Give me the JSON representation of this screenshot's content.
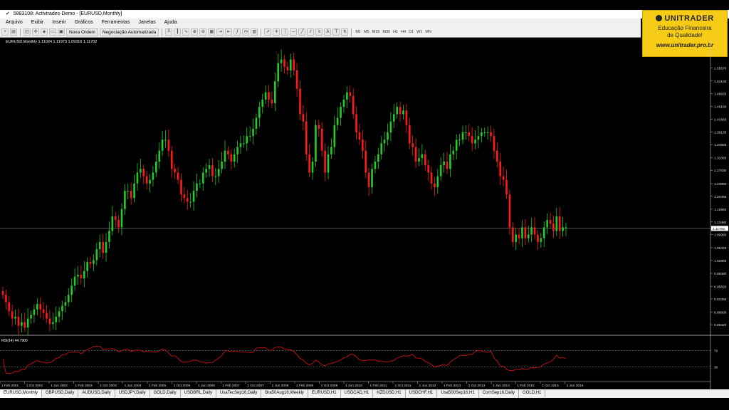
{
  "window": {
    "title": "5883108: Activtrades-Demo - [EURUSD,Monthly]"
  },
  "menu": [
    "Arquivo",
    "Exibir",
    "Inserir",
    "Gráficos",
    "Ferramentas",
    "Janelas",
    "Ajuda"
  ],
  "toolbar": {
    "new_order": "Nova Ordem",
    "auto_trading": "Negociação Automatizada",
    "timeframes": [
      "M1",
      "M5",
      "M15",
      "M30",
      "H1",
      "H4",
      "D1",
      "W1",
      "MN"
    ]
  },
  "banner": {
    "brand": "UNITRADER",
    "tagline_1": "Educação Financeira",
    "tagline_2": "de Qualidade!",
    "url": "www.unitrader.pro.br"
  },
  "chart_data": {
    "type": "candlestick",
    "symbol_info": "EURUSD,Monthly  1.11024 1.11973 1.09316 1.11702",
    "current_price": "1.11702",
    "ylim": [
      0.83,
      1.62
    ],
    "yticks": [
      "1.55670",
      "1.52100",
      "1.48635",
      "1.45150",
      "1.41660",
      "1.38135",
      "1.34665",
      "1.31095",
      "1.27630",
      "1.23960",
      "1.20495",
      "1.16960",
      "1.13460",
      "1.09990",
      "1.06425",
      "1.02885",
      "0.99380",
      "0.95820",
      "0.92355",
      "0.88800",
      "0.85320"
    ],
    "xticks": [
      "1 Feb 2001",
      "1 Oct 2001",
      "1 Jun 2002",
      "1 Feb 2003",
      "1 Oct 2003",
      "1 Jun 2004",
      "1 Feb 2005",
      "1 Oct 2005",
      "1 Jun 2006",
      "1 Feb 2007",
      "1 Oct 2007",
      "1 Jun 2008",
      "1 Feb 2009",
      "1 Oct 2009",
      "1 Jun 2010",
      "1 Feb 2011",
      "1 Oct 2011",
      "1 Jun 2012",
      "1 Feb 2013",
      "1 Oct 2013",
      "1 Jun 2014",
      "1 Feb 2015",
      "1 Oct 2015",
      "1 Jun 2016"
    ],
    "closes": [
      0.935,
      0.915,
      0.89,
      0.87,
      0.875,
      0.85,
      0.86,
      0.845,
      0.87,
      0.88,
      0.895,
      0.91,
      0.895,
      0.885,
      0.87,
      0.855,
      0.86,
      0.875,
      0.89,
      0.905,
      0.915,
      0.935,
      0.96,
      0.985,
      0.99,
      0.98,
      1.0,
      1.025,
      1.02,
      1.03,
      1.06,
      1.08,
      1.05,
      1.08,
      1.11,
      1.15,
      1.14,
      1.12,
      1.17,
      1.22,
      1.22,
      1.2,
      1.24,
      1.27,
      1.28,
      1.26,
      1.24,
      1.25,
      1.27,
      1.3,
      1.33,
      1.36,
      1.36,
      1.33,
      1.28,
      1.27,
      1.25,
      1.21,
      1.2,
      1.19,
      1.19,
      1.22,
      1.24,
      1.24,
      1.27,
      1.28,
      1.29,
      1.26,
      1.26,
      1.28,
      1.3,
      1.33,
      1.32,
      1.3,
      1.32,
      1.34,
      1.35,
      1.35,
      1.37,
      1.37,
      1.39,
      1.42,
      1.45,
      1.47,
      1.49,
      1.47,
      1.46,
      1.52,
      1.57,
      1.58,
      1.56,
      1.55,
      1.58,
      1.55,
      1.5,
      1.43,
      1.41,
      1.32,
      1.27,
      1.3,
      1.4,
      1.39,
      1.33,
      1.27,
      1.32,
      1.34,
      1.4,
      1.42,
      1.45,
      1.47,
      1.49,
      1.48,
      1.43,
      1.38,
      1.36,
      1.33,
      1.27,
      1.23,
      1.28,
      1.3,
      1.32,
      1.35,
      1.36,
      1.38,
      1.41,
      1.43,
      1.45,
      1.43,
      1.44,
      1.4,
      1.35,
      1.34,
      1.3,
      1.31,
      1.32,
      1.29,
      1.27,
      1.24,
      1.23,
      1.26,
      1.29,
      1.3,
      1.28,
      1.32,
      1.33,
      1.36,
      1.36,
      1.38,
      1.38,
      1.37,
      1.35,
      1.36,
      1.37,
      1.38,
      1.38,
      1.38,
      1.37,
      1.33,
      1.3,
      1.26,
      1.25,
      1.21,
      1.12,
      1.08,
      1.1,
      1.09,
      1.12,
      1.09,
      1.1,
      1.12,
      1.1,
      1.08,
      1.09,
      1.12,
      1.14,
      1.13,
      1.11,
      1.15,
      1.11,
      1.12,
      1.12
    ],
    "rsi": {
      "label": "RSI(14) 44.7900",
      "levels": [
        "70",
        "30"
      ]
    }
  },
  "tabs": [
    "EURUSD,Monthly",
    "GBPUSD,Daily",
    "AUDUSD,Daily",
    "USDJPY,Daily",
    "GOLD,Daily",
    "USDBRL,Daily",
    "UsaTecSep16,Daily",
    "Bra50Aug16,Weekly",
    "EURUSD,H1",
    "USDCAD,H1",
    "NZDUSD,H1",
    "USDCHF,H1",
    "Usa500Sep16,H1",
    "CornSep16,Daily",
    "GOLD,H1"
  ]
}
